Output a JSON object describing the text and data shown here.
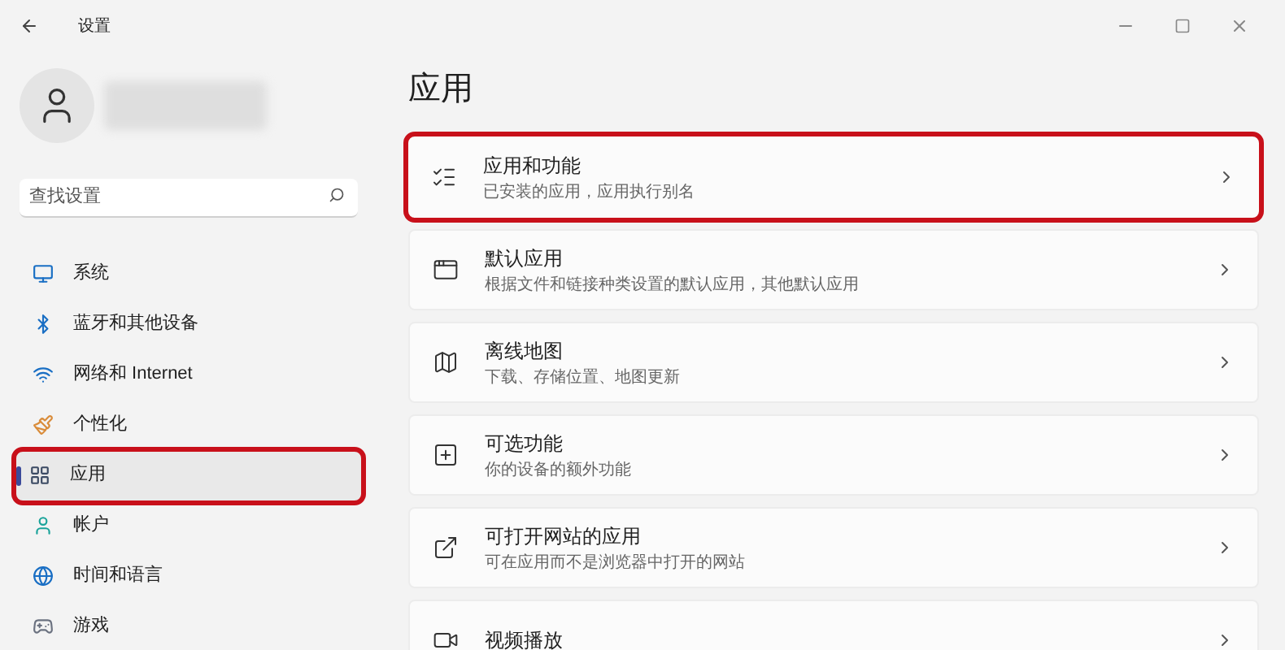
{
  "window": {
    "title": "设置"
  },
  "search": {
    "placeholder": "查找设置"
  },
  "sidebar": {
    "items": [
      {
        "label": "系统",
        "selected": false,
        "highlighted": false
      },
      {
        "label": "蓝牙和其他设备",
        "selected": false,
        "highlighted": false
      },
      {
        "label": "网络和 Internet",
        "selected": false,
        "highlighted": false
      },
      {
        "label": "个性化",
        "selected": false,
        "highlighted": false
      },
      {
        "label": "应用",
        "selected": true,
        "highlighted": true
      },
      {
        "label": "帐户",
        "selected": false,
        "highlighted": false
      },
      {
        "label": "时间和语言",
        "selected": false,
        "highlighted": false
      },
      {
        "label": "游戏",
        "selected": false,
        "highlighted": false
      }
    ]
  },
  "page": {
    "heading": "应用",
    "cards": [
      {
        "title": "应用和功能",
        "subtitle": "已安装的应用，应用执行别名",
        "highlighted": true
      },
      {
        "title": "默认应用",
        "subtitle": "根据文件和链接种类设置的默认应用，其他默认应用",
        "highlighted": false
      },
      {
        "title": "离线地图",
        "subtitle": "下载、存储位置、地图更新",
        "highlighted": false
      },
      {
        "title": "可选功能",
        "subtitle": "你的设备的额外功能",
        "highlighted": false
      },
      {
        "title": "可打开网站的应用",
        "subtitle": "可在应用而不是浏览器中打开的网站",
        "highlighted": false
      },
      {
        "title": "视频播放",
        "highlighted": false
      }
    ]
  }
}
